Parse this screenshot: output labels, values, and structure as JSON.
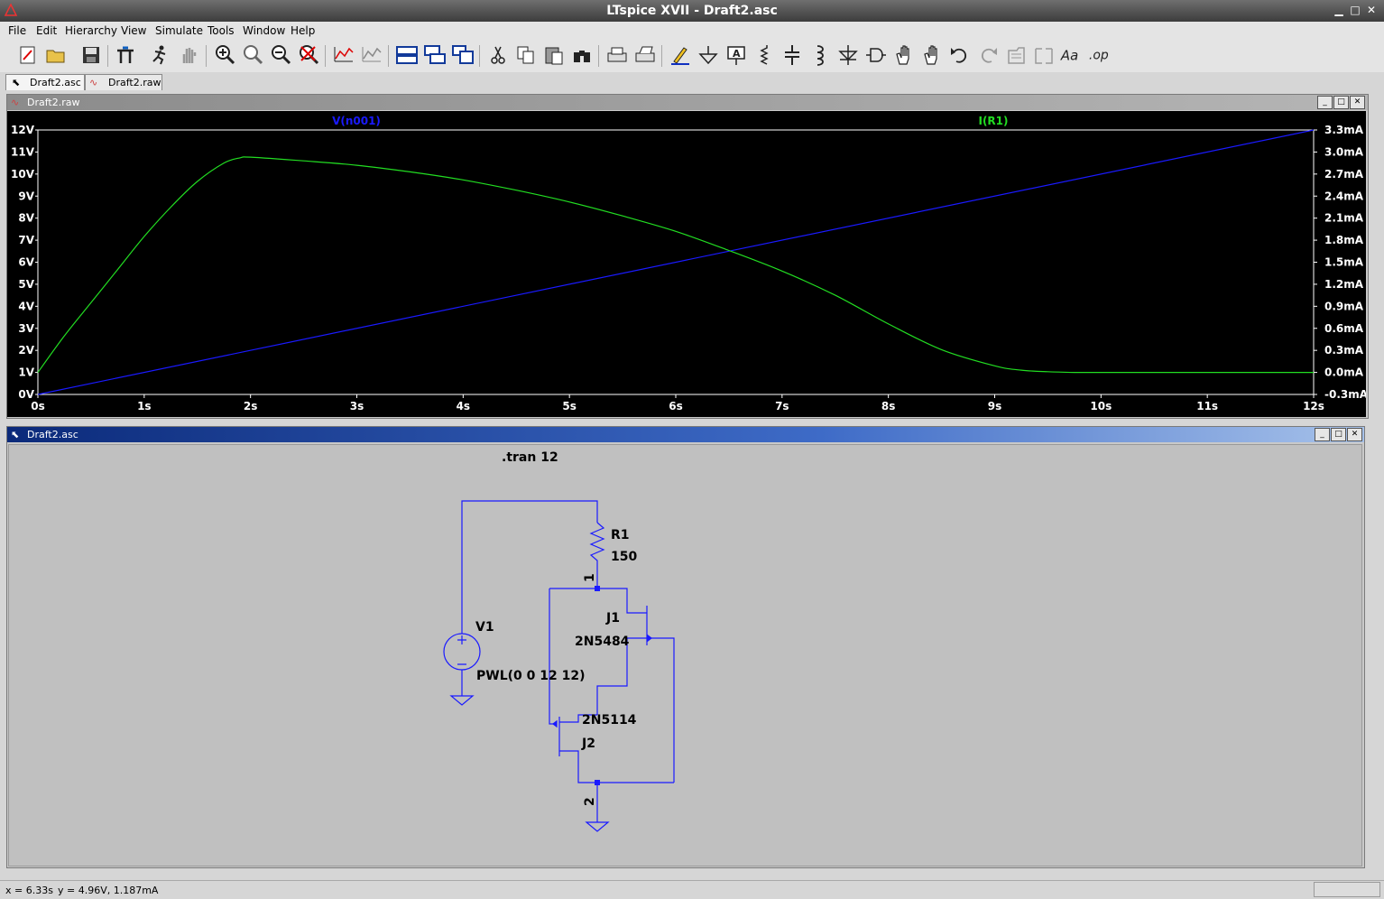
{
  "app": {
    "title": "LTspice XVII - Draft2.asc"
  },
  "window_controls": {
    "minimize": "▁",
    "maximize": "□",
    "close": "✕"
  },
  "menu": [
    "File",
    "Edit",
    "Hierarchy",
    "View",
    "Simulate",
    "Tools",
    "Window",
    "Help"
  ],
  "toolbar": {
    "icons": [
      "new-schematic-icon",
      "open-icon",
      "save-icon",
      "control-panel-icon",
      "run-icon",
      "halt-icon",
      "zoom-in-icon",
      "zoom-full-icon",
      "zoom-out-icon",
      "zoom-cancel-icon",
      "autorange-icon",
      "manual-limits-icon",
      "tile-horizontal-icon",
      "cascade-icon",
      "tile-vertical-icon",
      "cut-icon",
      "copy-icon",
      "paste-icon",
      "find-icon",
      "print-icon",
      "print-setup-icon",
      "draw-wire-icon",
      "ground-icon",
      "label-net-icon",
      "resistor-icon",
      "capacitor-icon",
      "inductor-icon",
      "diode-icon",
      "component-icon",
      "move-icon",
      "drag-icon",
      "undo-icon",
      "redo-icon",
      "rotate-icon",
      "mirror-icon",
      "text-icon",
      "spice-directive-icon"
    ],
    "text_icon_label": "Aa",
    "op_icon_label": ".op"
  },
  "tabs": [
    {
      "label": "Draft2.asc",
      "active": true
    },
    {
      "label": "Draft2.raw",
      "active": false
    }
  ],
  "plot_window": {
    "title": "Draft2.raw",
    "trace_labels": [
      "V(n001)",
      "I(R1)"
    ]
  },
  "schematic_window": {
    "title": "Draft2.asc",
    "directive": ".tran 12",
    "components": {
      "r1_name": "R1",
      "r1_value": "150",
      "v1_name": "V1",
      "v1_value": "PWL(0 0 12 12)",
      "j1_name": "J1",
      "j1_model": "2N5484",
      "j2_name": "J2",
      "j2_model": "2N5114",
      "node1": "1",
      "node2": "2"
    }
  },
  "status": {
    "x_readout": "x = 6.33s",
    "y_readout": "y = 4.96V, 1.187mA"
  },
  "chart_data": {
    "type": "line",
    "title": "",
    "xlabel": "",
    "x_ticks": [
      "0s",
      "1s",
      "2s",
      "3s",
      "4s",
      "5s",
      "6s",
      "7s",
      "8s",
      "9s",
      "10s",
      "11s",
      "12s"
    ],
    "xlim": [
      0,
      12
    ],
    "left_axis": {
      "ticks": [
        "0V",
        "1V",
        "2V",
        "3V",
        "4V",
        "5V",
        "6V",
        "7V",
        "8V",
        "9V",
        "10V",
        "11V",
        "12V"
      ],
      "ylim": [
        0,
        12
      ]
    },
    "right_axis": {
      "ticks": [
        "-0.3mA",
        "0.0mA",
        "0.3mA",
        "0.6mA",
        "0.9mA",
        "1.2mA",
        "1.5mA",
        "1.8mA",
        "2.1mA",
        "2.4mA",
        "2.7mA",
        "3.0mA",
        "3.3mA"
      ],
      "ylim": [
        -0.3,
        3.3
      ]
    },
    "grid": false,
    "background": "#000000",
    "series": [
      {
        "name": "V(n001)",
        "color": "#1a1aff",
        "axis": "left",
        "x": [
          0,
          12
        ],
        "y": [
          0,
          12
        ]
      },
      {
        "name": "I(R1)",
        "color": "#22dd22",
        "axis": "right",
        "x": [
          0,
          0.25,
          0.5,
          0.75,
          1.0,
          1.25,
          1.5,
          1.75,
          1.9,
          2.0,
          2.5,
          3.0,
          3.5,
          4.0,
          4.5,
          5.0,
          5.5,
          6.0,
          6.5,
          7.0,
          7.5,
          8.0,
          8.5,
          9.0,
          9.25,
          9.5,
          9.75,
          10,
          11,
          12
        ],
        "y": [
          0.0,
          0.5,
          0.95,
          1.4,
          1.85,
          2.25,
          2.6,
          2.85,
          2.92,
          2.93,
          2.88,
          2.82,
          2.73,
          2.62,
          2.48,
          2.32,
          2.13,
          1.92,
          1.66,
          1.38,
          1.05,
          0.66,
          0.31,
          0.09,
          0.03,
          0.01,
          0.0,
          0.0,
          0.0,
          0.0
        ]
      }
    ]
  }
}
